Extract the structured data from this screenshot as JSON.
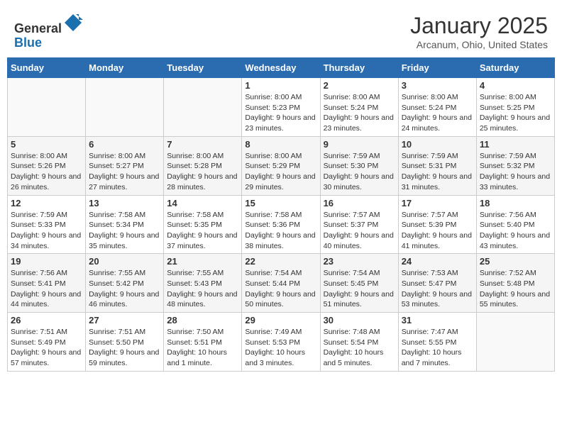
{
  "header": {
    "logo_general": "General",
    "logo_blue": "Blue",
    "month": "January 2025",
    "location": "Arcanum, Ohio, United States"
  },
  "weekdays": [
    "Sunday",
    "Monday",
    "Tuesday",
    "Wednesday",
    "Thursday",
    "Friday",
    "Saturday"
  ],
  "weeks": [
    [
      {
        "day": "",
        "sunrise": "",
        "sunset": "",
        "daylight": ""
      },
      {
        "day": "",
        "sunrise": "",
        "sunset": "",
        "daylight": ""
      },
      {
        "day": "",
        "sunrise": "",
        "sunset": "",
        "daylight": ""
      },
      {
        "day": "1",
        "sunrise": "Sunrise: 8:00 AM",
        "sunset": "Sunset: 5:23 PM",
        "daylight": "Daylight: 9 hours and 23 minutes."
      },
      {
        "day": "2",
        "sunrise": "Sunrise: 8:00 AM",
        "sunset": "Sunset: 5:24 PM",
        "daylight": "Daylight: 9 hours and 23 minutes."
      },
      {
        "day": "3",
        "sunrise": "Sunrise: 8:00 AM",
        "sunset": "Sunset: 5:24 PM",
        "daylight": "Daylight: 9 hours and 24 minutes."
      },
      {
        "day": "4",
        "sunrise": "Sunrise: 8:00 AM",
        "sunset": "Sunset: 5:25 PM",
        "daylight": "Daylight: 9 hours and 25 minutes."
      }
    ],
    [
      {
        "day": "5",
        "sunrise": "Sunrise: 8:00 AM",
        "sunset": "Sunset: 5:26 PM",
        "daylight": "Daylight: 9 hours and 26 minutes."
      },
      {
        "day": "6",
        "sunrise": "Sunrise: 8:00 AM",
        "sunset": "Sunset: 5:27 PM",
        "daylight": "Daylight: 9 hours and 27 minutes."
      },
      {
        "day": "7",
        "sunrise": "Sunrise: 8:00 AM",
        "sunset": "Sunset: 5:28 PM",
        "daylight": "Daylight: 9 hours and 28 minutes."
      },
      {
        "day": "8",
        "sunrise": "Sunrise: 8:00 AM",
        "sunset": "Sunset: 5:29 PM",
        "daylight": "Daylight: 9 hours and 29 minutes."
      },
      {
        "day": "9",
        "sunrise": "Sunrise: 7:59 AM",
        "sunset": "Sunset: 5:30 PM",
        "daylight": "Daylight: 9 hours and 30 minutes."
      },
      {
        "day": "10",
        "sunrise": "Sunrise: 7:59 AM",
        "sunset": "Sunset: 5:31 PM",
        "daylight": "Daylight: 9 hours and 31 minutes."
      },
      {
        "day": "11",
        "sunrise": "Sunrise: 7:59 AM",
        "sunset": "Sunset: 5:32 PM",
        "daylight": "Daylight: 9 hours and 33 minutes."
      }
    ],
    [
      {
        "day": "12",
        "sunrise": "Sunrise: 7:59 AM",
        "sunset": "Sunset: 5:33 PM",
        "daylight": "Daylight: 9 hours and 34 minutes."
      },
      {
        "day": "13",
        "sunrise": "Sunrise: 7:58 AM",
        "sunset": "Sunset: 5:34 PM",
        "daylight": "Daylight: 9 hours and 35 minutes."
      },
      {
        "day": "14",
        "sunrise": "Sunrise: 7:58 AM",
        "sunset": "Sunset: 5:35 PM",
        "daylight": "Daylight: 9 hours and 37 minutes."
      },
      {
        "day": "15",
        "sunrise": "Sunrise: 7:58 AM",
        "sunset": "Sunset: 5:36 PM",
        "daylight": "Daylight: 9 hours and 38 minutes."
      },
      {
        "day": "16",
        "sunrise": "Sunrise: 7:57 AM",
        "sunset": "Sunset: 5:37 PM",
        "daylight": "Daylight: 9 hours and 40 minutes."
      },
      {
        "day": "17",
        "sunrise": "Sunrise: 7:57 AM",
        "sunset": "Sunset: 5:39 PM",
        "daylight": "Daylight: 9 hours and 41 minutes."
      },
      {
        "day": "18",
        "sunrise": "Sunrise: 7:56 AM",
        "sunset": "Sunset: 5:40 PM",
        "daylight": "Daylight: 9 hours and 43 minutes."
      }
    ],
    [
      {
        "day": "19",
        "sunrise": "Sunrise: 7:56 AM",
        "sunset": "Sunset: 5:41 PM",
        "daylight": "Daylight: 9 hours and 44 minutes."
      },
      {
        "day": "20",
        "sunrise": "Sunrise: 7:55 AM",
        "sunset": "Sunset: 5:42 PM",
        "daylight": "Daylight: 9 hours and 46 minutes."
      },
      {
        "day": "21",
        "sunrise": "Sunrise: 7:55 AM",
        "sunset": "Sunset: 5:43 PM",
        "daylight": "Daylight: 9 hours and 48 minutes."
      },
      {
        "day": "22",
        "sunrise": "Sunrise: 7:54 AM",
        "sunset": "Sunset: 5:44 PM",
        "daylight": "Daylight: 9 hours and 50 minutes."
      },
      {
        "day": "23",
        "sunrise": "Sunrise: 7:54 AM",
        "sunset": "Sunset: 5:45 PM",
        "daylight": "Daylight: 9 hours and 51 minutes."
      },
      {
        "day": "24",
        "sunrise": "Sunrise: 7:53 AM",
        "sunset": "Sunset: 5:47 PM",
        "daylight": "Daylight: 9 hours and 53 minutes."
      },
      {
        "day": "25",
        "sunrise": "Sunrise: 7:52 AM",
        "sunset": "Sunset: 5:48 PM",
        "daylight": "Daylight: 9 hours and 55 minutes."
      }
    ],
    [
      {
        "day": "26",
        "sunrise": "Sunrise: 7:51 AM",
        "sunset": "Sunset: 5:49 PM",
        "daylight": "Daylight: 9 hours and 57 minutes."
      },
      {
        "day": "27",
        "sunrise": "Sunrise: 7:51 AM",
        "sunset": "Sunset: 5:50 PM",
        "daylight": "Daylight: 9 hours and 59 minutes."
      },
      {
        "day": "28",
        "sunrise": "Sunrise: 7:50 AM",
        "sunset": "Sunset: 5:51 PM",
        "daylight": "Daylight: 10 hours and 1 minute."
      },
      {
        "day": "29",
        "sunrise": "Sunrise: 7:49 AM",
        "sunset": "Sunset: 5:53 PM",
        "daylight": "Daylight: 10 hours and 3 minutes."
      },
      {
        "day": "30",
        "sunrise": "Sunrise: 7:48 AM",
        "sunset": "Sunset: 5:54 PM",
        "daylight": "Daylight: 10 hours and 5 minutes."
      },
      {
        "day": "31",
        "sunrise": "Sunrise: 7:47 AM",
        "sunset": "Sunset: 5:55 PM",
        "daylight": "Daylight: 10 hours and 7 minutes."
      },
      {
        "day": "",
        "sunrise": "",
        "sunset": "",
        "daylight": ""
      }
    ]
  ]
}
